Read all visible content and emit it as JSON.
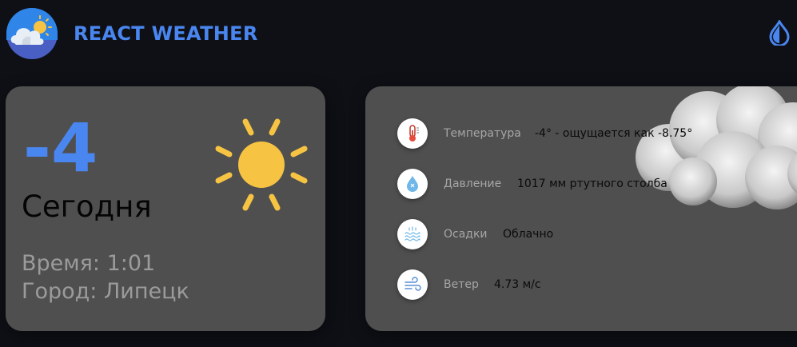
{
  "header": {
    "title": "REACT WEATHER",
    "logo_icon": "cloud-sun-logo-icon",
    "theme_toggle_icon": "drop-icon",
    "accent_color": "#4a86f0"
  },
  "today": {
    "temperature": "-4",
    "day_label": "Сегодня",
    "time_text": "Время: 1:01",
    "city_text": "Город: Липецк",
    "weather_icon": "sun-icon"
  },
  "details": {
    "items": [
      {
        "icon": "thermometer-icon",
        "label": "Температура",
        "value": "-4° - ощущается как -8.75°"
      },
      {
        "icon": "pressure-drop-icon",
        "label": "Давление",
        "value": "1017 мм ртутного столба"
      },
      {
        "icon": "precipitation-icon",
        "label": "Осадки",
        "value": "Облачно"
      },
      {
        "icon": "wind-icon",
        "label": "Ветер",
        "value": "4.73 м/с"
      }
    ],
    "background_icon": "cloud-icon"
  }
}
